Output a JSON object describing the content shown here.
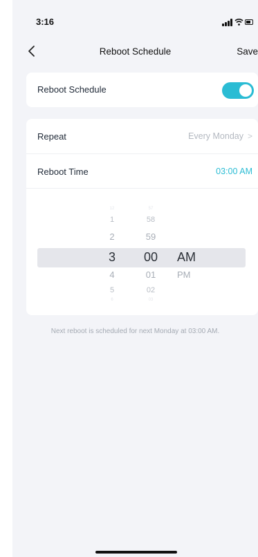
{
  "status": {
    "time": "3:16"
  },
  "nav": {
    "title": "Reboot Schedule",
    "save_label": "Save"
  },
  "toggle_card": {
    "label": "Reboot Schedule",
    "enabled": true,
    "accent_color": "#2bbcd4"
  },
  "schedule": {
    "repeat_label": "Repeat",
    "repeat_value": "Every Monday",
    "time_label": "Reboot Time",
    "time_value": "03:00 AM"
  },
  "picker": {
    "hours": [
      "12",
      "1",
      "2",
      "3",
      "4",
      "5",
      "6"
    ],
    "minutes": [
      "57",
      "58",
      "59",
      "00",
      "01",
      "02",
      "03"
    ],
    "periods": [
      "AM",
      "PM"
    ],
    "selected": {
      "hour": "3",
      "minute": "00",
      "period": "AM"
    }
  },
  "footer": {
    "note": "Next reboot is scheduled for next Monday at 03:00 AM."
  },
  "icons": [
    "back-icon",
    "chevron-right-icon",
    "signal-icon",
    "wifi-icon",
    "battery-icon"
  ]
}
